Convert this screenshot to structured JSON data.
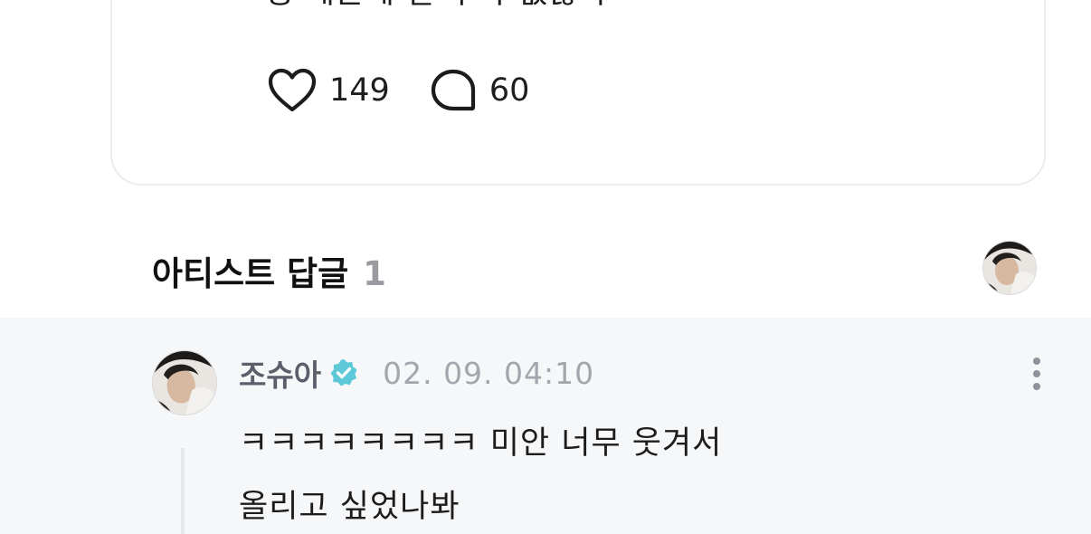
{
  "post": {
    "text": "형 때문에 잘 수가 없잖아 ㅋㅋㅋㅋㅋ",
    "like_count": "149",
    "comment_count": "60"
  },
  "replies": {
    "title": "아티스트 답글",
    "count": "1"
  },
  "reply": {
    "author": "조슈아",
    "timestamp": "02. 09. 04:10",
    "lines": [
      "ㅋㅋㅋㅋㅋㅋㅋㅋ 미안 너무 웃겨서",
      "올리고 싶었나봐"
    ]
  },
  "colors": {
    "verified_badge": "#5cc8d8",
    "reply_background": "#f6f7f9",
    "count_gray": "#9a9aa1"
  },
  "icons": {
    "like": "heart-outline-icon",
    "comment": "speech-bubble-icon",
    "verified": "verified-badge-icon",
    "more": "vertical-ellipsis-icon"
  }
}
